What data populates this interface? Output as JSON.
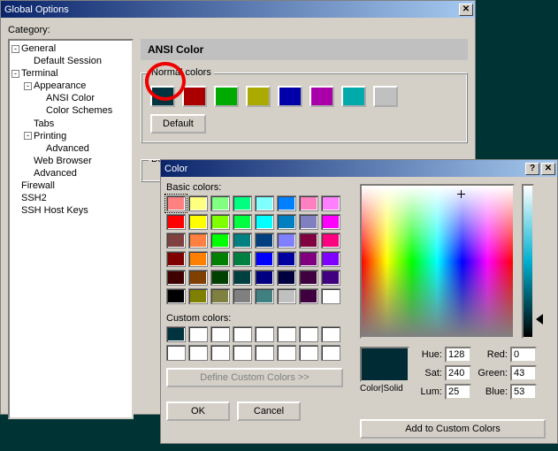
{
  "main": {
    "title": "Global Options",
    "category_label": "Category:",
    "tree": [
      {
        "label": "General",
        "expandable": true,
        "sign": "-",
        "indent": 0
      },
      {
        "label": "Default Session",
        "indent": 1,
        "leaf": true
      },
      {
        "label": "Terminal",
        "expandable": true,
        "sign": "-",
        "indent": 0
      },
      {
        "label": "Appearance",
        "expandable": true,
        "sign": "-",
        "indent": 1
      },
      {
        "label": "ANSI Color",
        "indent": 2,
        "leaf": true
      },
      {
        "label": "Color Schemes",
        "indent": 2,
        "leaf": true
      },
      {
        "label": "Tabs",
        "indent": 1,
        "leaf": true
      },
      {
        "label": "Printing",
        "expandable": true,
        "sign": "-",
        "indent": 1
      },
      {
        "label": "Advanced",
        "indent": 2,
        "leaf": true
      },
      {
        "label": "Web Browser",
        "indent": 1,
        "leaf": true
      },
      {
        "label": "Advanced",
        "indent": 1,
        "leaf": true
      },
      {
        "label": "Firewall",
        "indent": 0,
        "leaf": true
      },
      {
        "label": "SSH2",
        "indent": 0,
        "leaf": true
      },
      {
        "label": "SSH Host Keys",
        "indent": 0,
        "leaf": true
      }
    ],
    "section_ansi": "ANSI Color",
    "group_normal": "Normal colors",
    "group_bold_prefix": "Bo",
    "normal_colors": [
      "#003340",
      "#aa0000",
      "#00aa00",
      "#aaaa00",
      "#0000aa",
      "#aa00aa",
      "#00aaaa",
      "#c0c0c0"
    ],
    "default_btn": "Default"
  },
  "color": {
    "title": "Color",
    "basic_label": "Basic colors:",
    "basic_grid": [
      [
        "#ff8080",
        "#ffff80",
        "#80ff80",
        "#00ff80",
        "#80ffff",
        "#0080ff",
        "#ff80c0",
        "#ff80ff"
      ],
      [
        "#ff0000",
        "#ffff00",
        "#80ff00",
        "#00ff40",
        "#00ffff",
        "#0080c0",
        "#8080c0",
        "#ff00ff"
      ],
      [
        "#804040",
        "#ff8040",
        "#00ff00",
        "#008080",
        "#004080",
        "#8080ff",
        "#800040",
        "#ff0080"
      ],
      [
        "#800000",
        "#ff8000",
        "#008000",
        "#008040",
        "#0000ff",
        "#0000a0",
        "#800080",
        "#8000ff"
      ],
      [
        "#400000",
        "#804000",
        "#004000",
        "#004040",
        "#000080",
        "#000040",
        "#400040",
        "#400080"
      ],
      [
        "#000000",
        "#808000",
        "#808040",
        "#808080",
        "#408080",
        "#c0c0c0",
        "#400040",
        "#ffffff"
      ]
    ],
    "custom_label": "Custom colors:",
    "custom_colors_top": [
      "#003340",
      "#ffffff",
      "#ffffff",
      "#ffffff",
      "#ffffff",
      "#ffffff",
      "#ffffff",
      "#ffffff"
    ],
    "custom_colors_bottom": [
      "#ffffff",
      "#ffffff",
      "#ffffff",
      "#ffffff",
      "#ffffff",
      "#ffffff",
      "#ffffff",
      "#ffffff"
    ],
    "define_btn": "Define Custom Colors >>",
    "ok": "OK",
    "cancel": "Cancel",
    "colorsolid_label": "Color|Solid",
    "hue_label": "Hue:",
    "hue": "128",
    "sat_label": "Sat:",
    "sat": "240",
    "lum_label": "Lum:",
    "lum": "25",
    "red_label": "Red:",
    "red": "0",
    "green_label": "Green:",
    "green": "43",
    "blue_label": "Blue:",
    "blue": "53",
    "add_custom": "Add to Custom Colors"
  }
}
